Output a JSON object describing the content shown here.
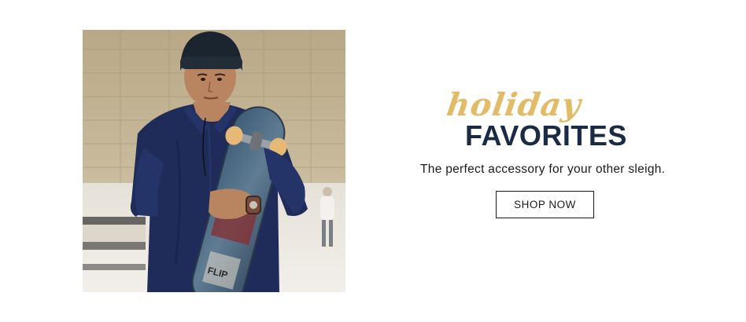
{
  "promo": {
    "script_title": "holiday",
    "main_title": "FAVORITES",
    "tagline": "The perfect accessory for your other sleigh.",
    "cta_label": "SHOP NOW"
  },
  "colors": {
    "script_gold": "#e2bb66",
    "title_navy": "#1b2b45",
    "shirt_navy": "#1f2c5a"
  }
}
